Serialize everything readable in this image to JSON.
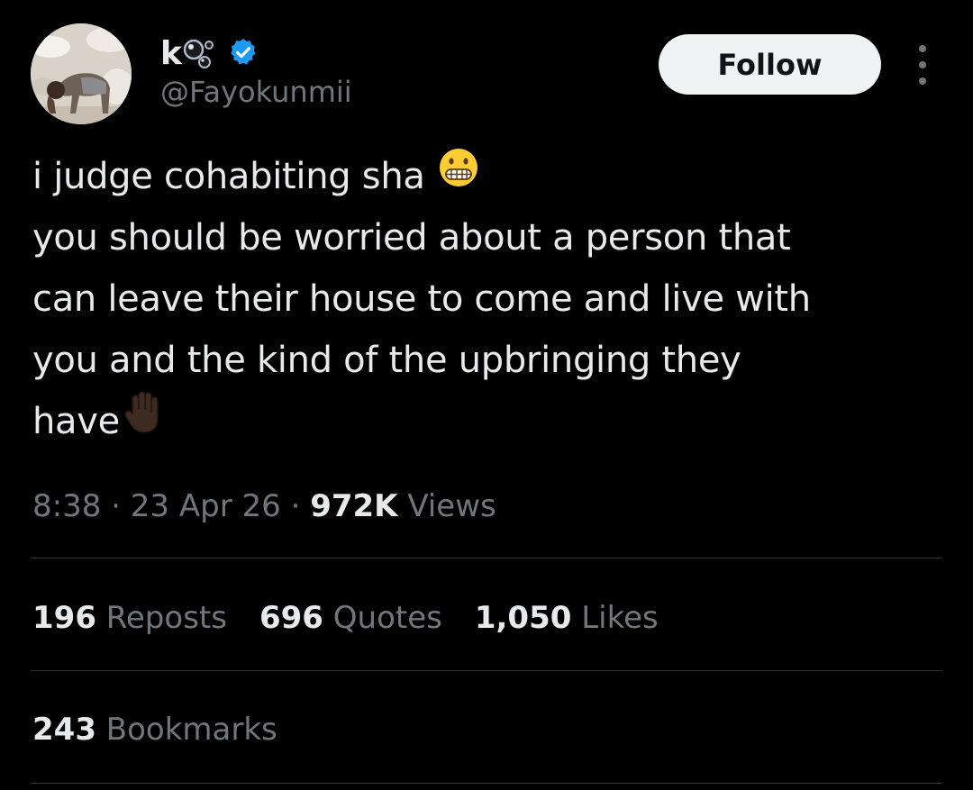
{
  "author": {
    "display_name": "k",
    "handle": "@Fayokunmii",
    "avatar_icon": "profile-photo",
    "verified_icon": "verified-badge-icon",
    "name_decoration_icon": "bubbles-emoji-icon"
  },
  "follow_button": {
    "label": "Follow"
  },
  "more_menu": {
    "icon": "more-dots-icon"
  },
  "tweet": {
    "lines": [
      "i judge cohabiting sha",
      "you should be worried about a person that",
      "can leave their house to come and live with",
      "you and the kind of the upbringing they",
      "have"
    ],
    "emoji_line1": "grimacing-face-emoji",
    "emoji_line5": "raised-hand-dark-skin-emoji"
  },
  "meta": {
    "time": "8:38",
    "date": "23 Apr 26",
    "views_count": "972K",
    "views_label": "Views",
    "separator": "·"
  },
  "stats": [
    {
      "count": "196",
      "label": "Reposts"
    },
    {
      "count": "696",
      "label": "Quotes"
    },
    {
      "count": "1,050",
      "label": "Likes"
    }
  ],
  "bookmarks": {
    "count": "243",
    "label": "Bookmarks"
  },
  "colors": {
    "background": "#000000",
    "text_primary": "#e7e9ea",
    "text_secondary": "#71767b",
    "divider": "#2f3336",
    "verified": "#1d9bf0",
    "button_bg": "#eff3f4"
  }
}
